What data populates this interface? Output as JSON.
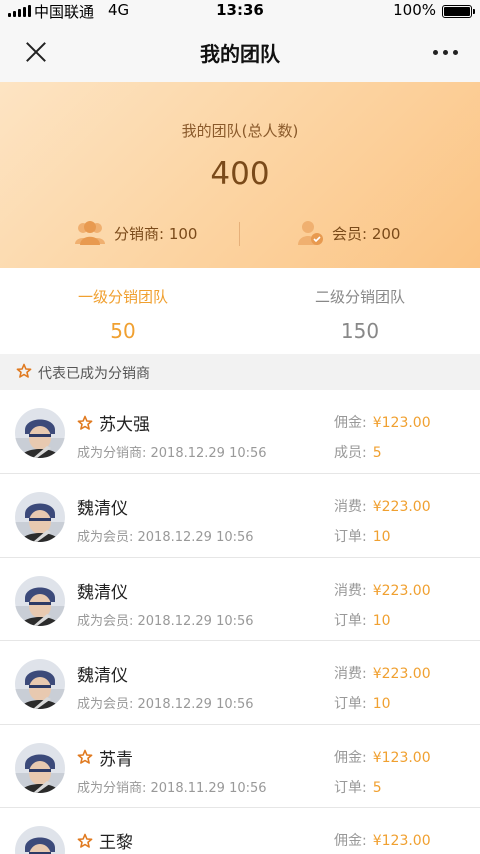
{
  "status_bar": {
    "carrier": "中国联通",
    "network": "4G",
    "time": "13:36",
    "battery": "100%"
  },
  "nav": {
    "title": "我的团队"
  },
  "banner": {
    "title": "我的团队(总人数)",
    "total": "400",
    "distributor_label": "分销商: 100",
    "member_label": "会员: 200"
  },
  "tabs": [
    {
      "label": "一级分销团队",
      "count": "50",
      "active": true
    },
    {
      "label": "二级分销团队",
      "count": "150",
      "active": false
    }
  ],
  "section": {
    "label": "代表已成为分销商"
  },
  "colors": {
    "accent": "#f0a030",
    "banner_from": "#fde4c3",
    "banner_to": "#fbc484"
  },
  "list": [
    {
      "name": "苏大强",
      "star": true,
      "sub": "成为分销商: 2018.12.29 10:56",
      "m1_label": "佣金:",
      "m1_value": "¥123.00",
      "m2_label": "成员:",
      "m2_value": "5"
    },
    {
      "name": "魏清仪",
      "star": false,
      "sub": "成为会员: 2018.12.29 10:56",
      "m1_label": "消费:",
      "m1_value": "¥223.00",
      "m2_label": "订单:",
      "m2_value": "10"
    },
    {
      "name": "魏清仪",
      "star": false,
      "sub": "成为会员: 2018.12.29 10:56",
      "m1_label": "消费:",
      "m1_value": "¥223.00",
      "m2_label": "订单:",
      "m2_value": "10"
    },
    {
      "name": "魏清仪",
      "star": false,
      "sub": "成为会员: 2018.12.29 10:56",
      "m1_label": "消费:",
      "m1_value": "¥223.00",
      "m2_label": "订单:",
      "m2_value": "10"
    },
    {
      "name": "苏青",
      "star": true,
      "sub": "成为分销商: 2018.11.29 10:56",
      "m1_label": "佣金:",
      "m1_value": "¥123.00",
      "m2_label": "订单:",
      "m2_value": "5"
    },
    {
      "name": "王黎",
      "star": true,
      "sub": "",
      "m1_label": "佣金:",
      "m1_value": "¥123.00",
      "m2_label": "",
      "m2_value": ""
    }
  ]
}
